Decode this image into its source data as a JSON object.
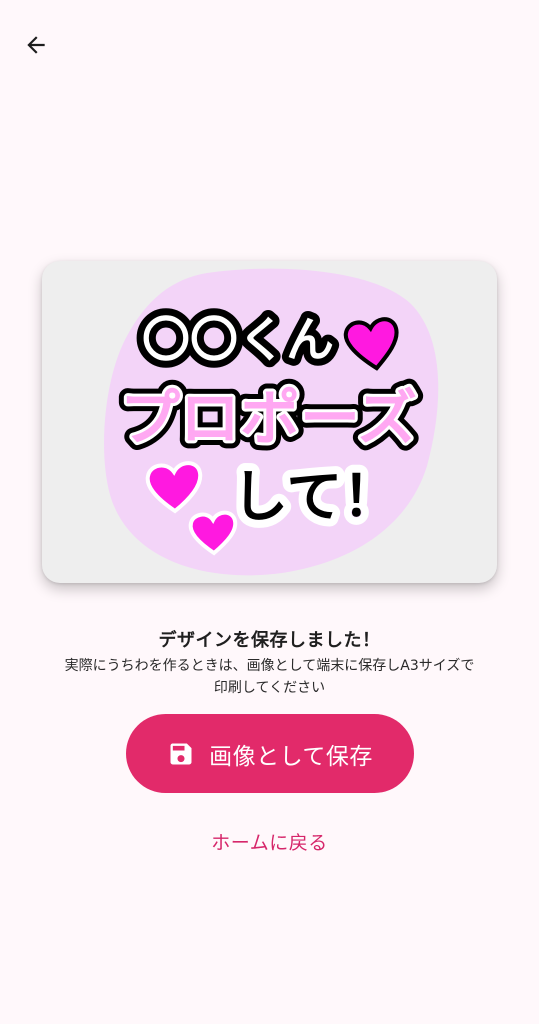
{
  "header": {
    "back_icon": "arrow-left-icon"
  },
  "preview": {
    "line1": "〇〇くん",
    "line2": "プロポーズ",
    "line3": "して！",
    "colors": {
      "card_bg": "#eeeeee",
      "blob": "#f3d4f8",
      "heart": "#ff19e0",
      "accent_text": "#ffa8f2"
    }
  },
  "message": {
    "title": "デザインを保存しました！",
    "description_line1": "実際にうちわを作るときは、画像として端末に保存しA3サイズで",
    "description_line2": "印刷してください"
  },
  "actions": {
    "save_label": "画像として保存",
    "save_icon": "floppy-disk-icon",
    "home_label": "ホームに戻る"
  },
  "colors": {
    "accent": "#e22a6a",
    "background": "#fff8fb"
  }
}
